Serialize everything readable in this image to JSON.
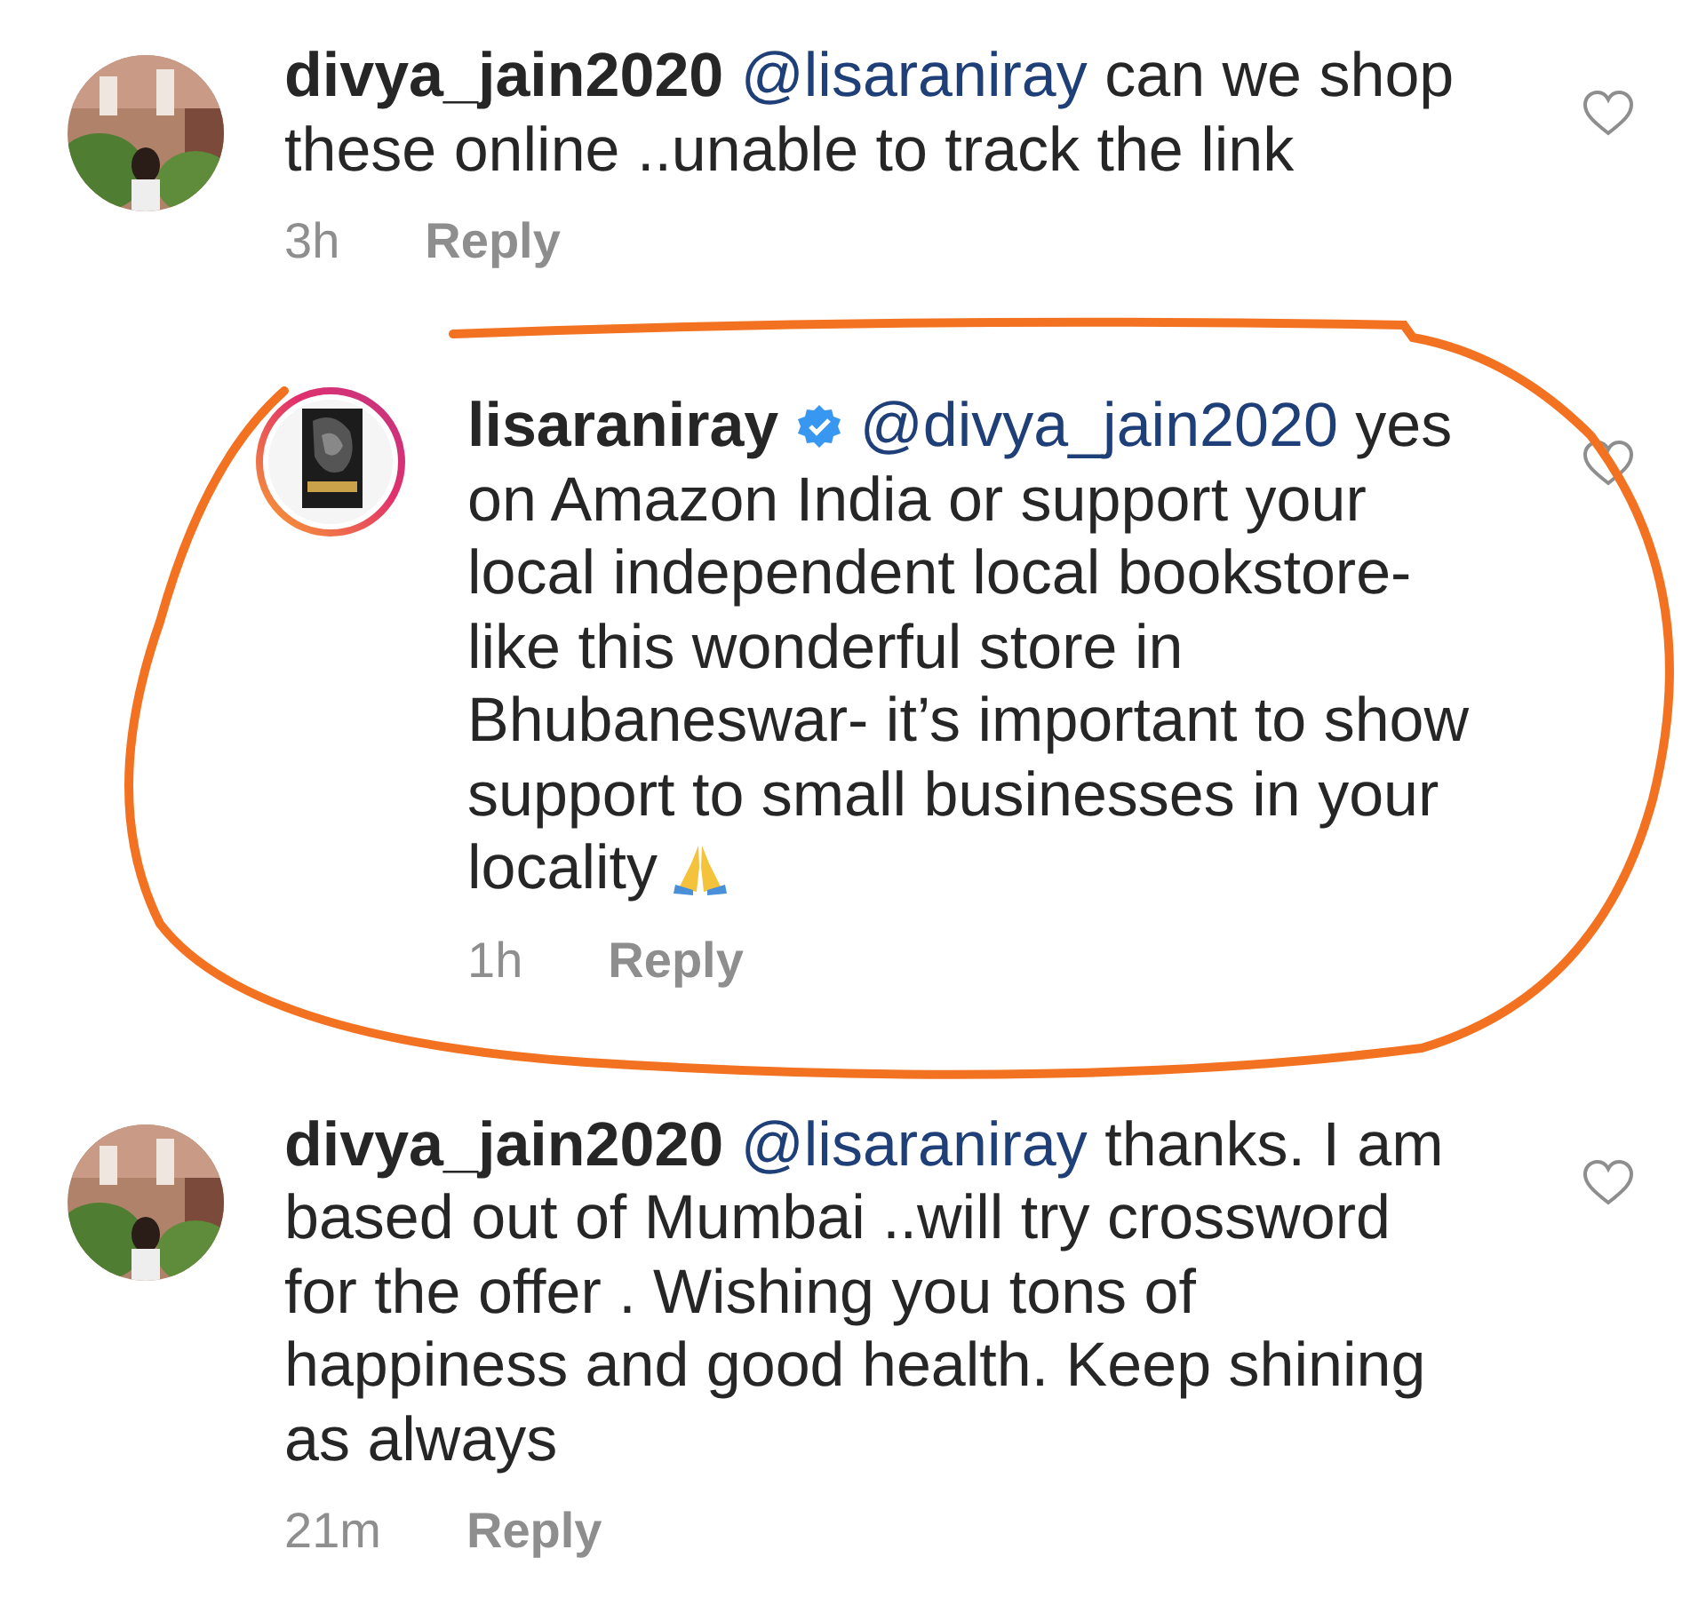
{
  "comments": [
    {
      "emoji_end": false,
      "story_ring": false,
      "username": "divya_jain2020",
      "verified": false,
      "mention": "@lisaraniray",
      "lines": [
        "can we shop",
        "these online ..unable to track the link"
      ],
      "time": "3h",
      "reply": "Reply",
      "circled": false,
      "children": [
        {
          "emoji_end": true,
          "story_ring": true,
          "username": "lisaraniray",
          "verified": true,
          "mention": "@divya_jain2020",
          "lines": [
            "yes",
            "on Amazon India or support your",
            "local independent local bookstore-",
            "like this wonderful store in",
            "Bhubaneswar- it’s important to show",
            "support to small businesses in your",
            "locality"
          ],
          "time": "1h",
          "reply": "Reply",
          "circled": true
        }
      ]
    },
    {
      "emoji_end": false,
      "story_ring": false,
      "username": "divya_jain2020",
      "verified": false,
      "mention": "@lisaraniray",
      "lines": [
        "thanks. I am",
        "based out of Mumbai ..will try crossword",
        "for the offer . Wishing you tons of",
        "happiness and good health. Keep shining",
        "as always"
      ],
      "time": "21m",
      "reply": "Reply",
      "circled": false
    }
  ]
}
